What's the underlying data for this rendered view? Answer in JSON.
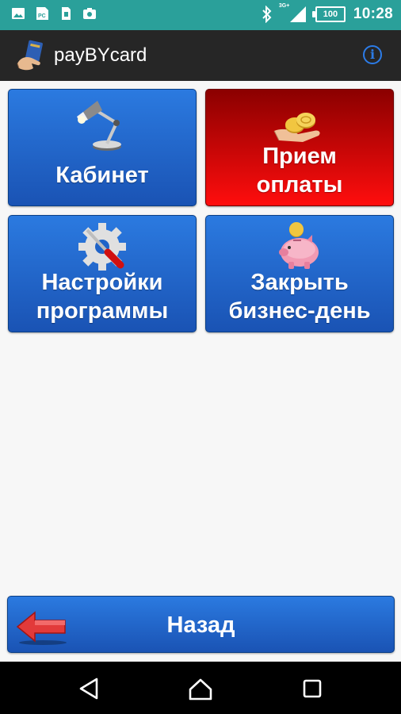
{
  "status_bar": {
    "time": "10:28",
    "battery": "100",
    "network": "3G+",
    "notification_icons": [
      "image-icon",
      "pc-icon",
      "sim-icon",
      "camera-icon"
    ]
  },
  "app_bar": {
    "title": "payBYcard",
    "info_icon": "info-icon"
  },
  "menu": {
    "tiles": [
      {
        "label_line1": "Кабинет",
        "label_line2": "",
        "icon": "desk-lamp-icon",
        "color": "#1f63c8"
      },
      {
        "label_line1": "Прием",
        "label_line2": "оплаты",
        "icon": "coins-in-hand-icon",
        "color": "#e00000"
      },
      {
        "label_line1": "Настройки",
        "label_line2": "программы",
        "icon": "gear-screwdriver-icon",
        "color": "#1f63c8"
      },
      {
        "label_line1": "Закрыть",
        "label_line2": "бизнес-день",
        "icon": "piggy-bank-icon",
        "color": "#1f63c8"
      }
    ]
  },
  "back_button": {
    "label": "Назад",
    "icon": "back-arrow-icon"
  },
  "nav_bar": {
    "icons": [
      "back-triangle-icon",
      "home-icon",
      "recents-icon"
    ]
  }
}
